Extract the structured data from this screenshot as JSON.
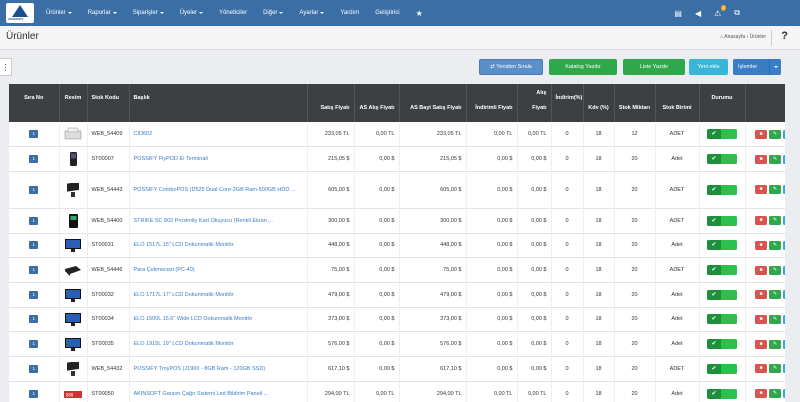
{
  "nav": {
    "items": [
      {
        "label": "Ürünler",
        "caret": true
      },
      {
        "label": "Raporlar",
        "caret": true
      },
      {
        "label": "Siparişler",
        "caret": true
      },
      {
        "label": "Üyeler",
        "caret": true
      },
      {
        "label": "Yöneticiler",
        "caret": false
      },
      {
        "label": "Diğer",
        "caret": true
      },
      {
        "label": "Ayarlar",
        "caret": true
      },
      {
        "label": "Yardım",
        "caret": false
      },
      {
        "label": "Geliştirici",
        "caret": false
      }
    ],
    "star": "★",
    "notification_count": "2",
    "logo_text": "AKINSOFT"
  },
  "header": {
    "title": "Ürünler",
    "breadcrumb_home": "Anasayfa",
    "breadcrumb_current": "Ürünler",
    "help": "?"
  },
  "toolbar": {
    "reorder": "Yeniden Sırala",
    "catalog": "Katalog Yazdır",
    "list": "Liste Yazdır",
    "new": "Yeni ekle",
    "ops": "İşlemler"
  },
  "table": {
    "headers": {
      "sira": "Sıra No",
      "resim": "Resim",
      "stok_kodu": "Stok Kodu",
      "baslik": "Başlık",
      "satis": "Satış Fiyatı",
      "as_alis": "AS Alış Fiyatı",
      "as_bayi": "AS Bayi Satış Fiyatı",
      "indirimli": "İndirimli Fiyatı",
      "alis": "Alış Fiyatı",
      "indirim": "İndirim(%)",
      "kdv": "Kdv (%)",
      "stok_miktari": "Stok Miktarı",
      "stok_birimi": "Stok Birimi",
      "durum": "Durumu"
    },
    "rows": [
      {
        "sira": "1",
        "kod": "WEB_54409",
        "baslik": "CID602",
        "satis": "233,05 TL",
        "as_alis": "0,00 TL",
        "as_bayi": "233,05 TL",
        "indirimli": "0,00 TL",
        "alis": "0,00 TL",
        "indirim": "0",
        "kdv": "18",
        "stok": "12",
        "birim": "ADET",
        "img": "printer"
      },
      {
        "sira": "1",
        "kod": "ST00007",
        "baslik": "POSSIFY FlyPOD El Terminali",
        "satis": "215,05 $",
        "as_alis": "0,00 $",
        "as_bayi": "215,05 $",
        "indirimli": "0,00 $",
        "alis": "0,00 $",
        "indirim": "0",
        "kdv": "18",
        "stok": "20",
        "birim": "Adet",
        "img": "handheld"
      },
      {
        "sira": "1",
        "kod": "WEB_54443",
        "baslik": "POSSIFY ComboPOS (D525 Dual Core-2GB Ram-500GB HDD ...",
        "satis": "605,00 $",
        "as_alis": "0,00 $",
        "as_bayi": "605,00 $",
        "indirimli": "0,00 $",
        "alis": "0,00 $",
        "indirim": "0",
        "kdv": "18",
        "stok": "20",
        "birim": "ADET",
        "img": "pos"
      },
      {
        "sira": "1",
        "kod": "WEB_54400",
        "baslik": "STRIKE SC 802 Proximity Kart Okuyucu (Renkli Ekran ...",
        "satis": "300,00 $",
        "as_alis": "0,00 $",
        "as_bayi": "300,00 $",
        "indirimli": "0,00 $",
        "alis": "0,00 $",
        "indirim": "0",
        "kdv": "18",
        "stok": "20",
        "birim": "ADET",
        "img": "reader"
      },
      {
        "sira": "1",
        "kod": "ST00031",
        "baslik": "ELO 1517L 15\" LCD Dokunmatik Monitör",
        "satis": "448,00 $",
        "as_alis": "0,00 $",
        "as_bayi": "448,00 $",
        "indirimli": "0,00 $",
        "alis": "0,00 $",
        "indirim": "0",
        "kdv": "18",
        "stok": "20",
        "birim": "Adet",
        "img": "monitor"
      },
      {
        "sira": "1",
        "kod": "WEB_54446",
        "baslik": "Para Çekmecesi (PC-40)",
        "satis": "75,00 $",
        "as_alis": "0,00 $",
        "as_bayi": "75,00 $",
        "indirimli": "0,00 $",
        "alis": "0,00 $",
        "indirim": "0",
        "kdv": "18",
        "stok": "20",
        "birim": "ADET",
        "img": "drawer"
      },
      {
        "sira": "1",
        "kod": "ST00032",
        "baslik": "ELO 1717L 17\" LCD Dokunmatik Monitör",
        "satis": "479,00 $",
        "as_alis": "0,00 $",
        "as_bayi": "479,00 $",
        "indirimli": "0,00 $",
        "alis": "0,00 $",
        "indirim": "0",
        "kdv": "18",
        "stok": "20",
        "birim": "Adet",
        "img": "monitor"
      },
      {
        "sira": "1",
        "kod": "ST00034",
        "baslik": "ELO 1500L 15.6\" Wide LCD Dokunmatik Monitör",
        "satis": "373,00 $",
        "as_alis": "0,00 $",
        "as_bayi": "373,00 $",
        "indirimli": "0,00 $",
        "alis": "0,00 $",
        "indirim": "0",
        "kdv": "18",
        "stok": "20",
        "birim": "Adet",
        "img": "monitor"
      },
      {
        "sira": "1",
        "kod": "ST00035",
        "baslik": "ELO 1915L 19\" LCD Dokunmatik Monitör",
        "satis": "576,00 $",
        "as_alis": "0,00 $",
        "as_bayi": "576,00 $",
        "indirimli": "0,00 $",
        "alis": "0,00 $",
        "indirim": "0",
        "kdv": "18",
        "stok": "20",
        "birim": "Adet",
        "img": "monitor"
      },
      {
        "sira": "1",
        "kod": "WEB_54432",
        "baslik": "POSSIFY TroyPOS (J1900 - 8GB Ram - 120GB SSD)",
        "satis": "617,10 $",
        "as_alis": "0,00 $",
        "as_bayi": "617,10 $",
        "indirimli": "0,00 $",
        "alis": "0,00 $",
        "indirim": "0",
        "kdv": "18",
        "stok": "20",
        "birim": "ADET",
        "img": "pos"
      },
      {
        "sira": "1",
        "kod": "ST00050",
        "baslik": "AKINSOFT Garson Çağrı Sistemi Led Bildirim Paneli ...",
        "satis": "294,00 TL",
        "as_alis": "0,00 TL",
        "as_bayi": "294,00 TL",
        "indirimli": "0,00 TL",
        "alis": "0,00 TL",
        "indirim": "0",
        "kdv": "18",
        "stok": "20",
        "birim": "Adet",
        "img": "panel"
      }
    ]
  },
  "colors": {
    "topbar": "#3a6ea5",
    "green": "#2ea84a",
    "red": "#d9534f",
    "cyan": "#38a8e0"
  }
}
